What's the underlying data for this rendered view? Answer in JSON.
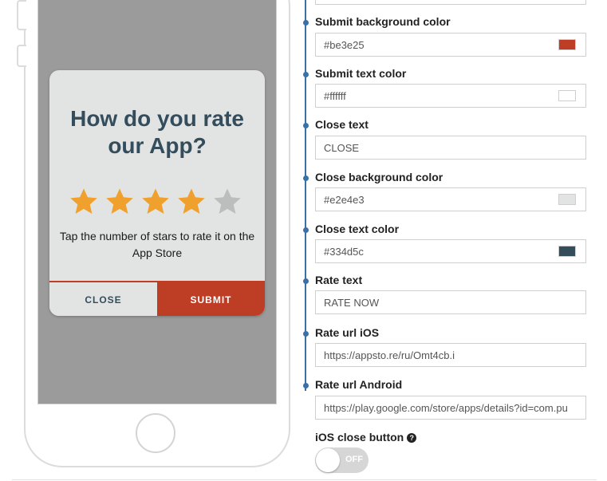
{
  "dialog": {
    "title": "How do you rate our App?",
    "rating": 4,
    "max_rating": 5,
    "instruction": "Tap the number of stars to rate it on the App Store",
    "close_label": "CLOSE",
    "submit_label": "SUBMIT"
  },
  "colors": {
    "star_filled": "#f0a02c",
    "star_empty": "#bdbdbd",
    "accent": "#be3e25",
    "timeline": "#3a70a8"
  },
  "fields": {
    "submit_bg": {
      "label": "Submit background color",
      "value": "#be3e25",
      "swatch": "#be3e25"
    },
    "submit_text": {
      "label": "Submit text color",
      "value": "#ffffff",
      "swatch": "#ffffff"
    },
    "close_text": {
      "label": "Close text",
      "value": "CLOSE"
    },
    "close_bg": {
      "label": "Close background color",
      "value": "#e2e4e3",
      "swatch": "#e2e4e3"
    },
    "close_text_color": {
      "label": "Close text color",
      "value": "#334d5c",
      "swatch": "#334d5c"
    },
    "rate_text": {
      "label": "Rate text",
      "value": "RATE NOW"
    },
    "rate_url_ios": {
      "label": "Rate url iOS",
      "value": "https://appsto.re/ru/Omt4cb.i"
    },
    "rate_url_android": {
      "label": "Rate url Android",
      "value": "https://play.google.com/store/apps/details?id=com.pu"
    }
  },
  "ios_close_button": {
    "label": "iOS close button",
    "help_icon": "question-circle-icon",
    "state": "OFF"
  }
}
